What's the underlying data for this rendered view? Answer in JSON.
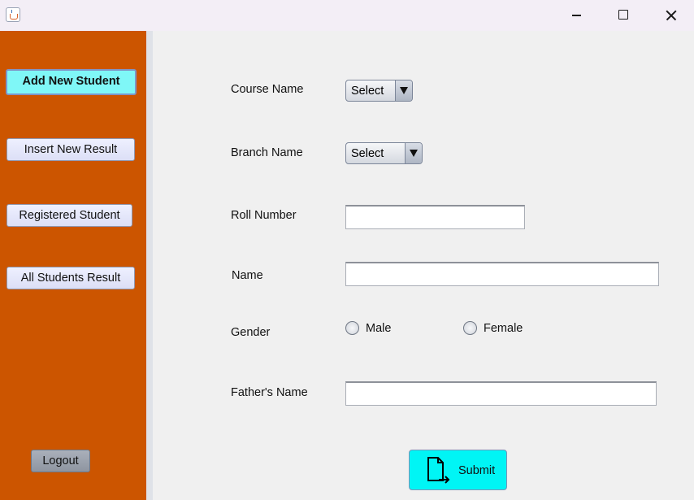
{
  "window": {
    "icon": "java-cup-icon",
    "controls": [
      "minimize",
      "maximize",
      "close"
    ]
  },
  "sidebar": {
    "background": "#cc5500",
    "items": [
      {
        "label": "Add New Student",
        "active": true
      },
      {
        "label": "Insert New Result",
        "active": false
      },
      {
        "label": "Registered Student",
        "active": false
      },
      {
        "label": "All Students Result",
        "active": false
      }
    ],
    "logout_label": "Logout"
  },
  "form": {
    "course": {
      "label": "Course Name",
      "selected": "Select"
    },
    "branch": {
      "label": "Branch Name",
      "selected": "Select"
    },
    "roll": {
      "label": "Roll Number",
      "value": ""
    },
    "name": {
      "label": "Name",
      "value": ""
    },
    "gender": {
      "label": "Gender",
      "options": [
        "Male",
        "Female"
      ],
      "selected": null
    },
    "father": {
      "label": "Father's Name",
      "value": ""
    },
    "submit": {
      "label": "Submit",
      "icon": "document-export-icon",
      "color": "#00f5f5"
    }
  }
}
